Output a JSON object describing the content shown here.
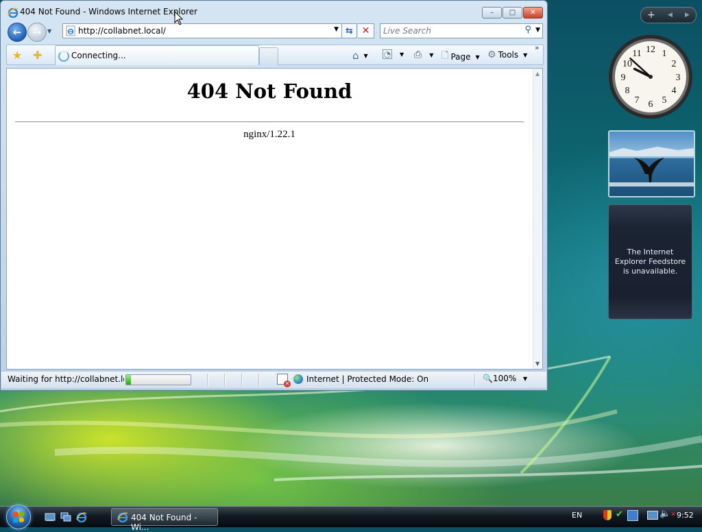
{
  "window": {
    "title": "404 Not Found - Windows Internet Explorer",
    "controls": {
      "minimize": "–",
      "maximize": "□",
      "close": "✕"
    }
  },
  "navbar": {
    "address": "http://collabnet.local/",
    "search_placeholder": "Live Search"
  },
  "commandbar": {
    "tab_label": "Connecting...",
    "page_label": "Page",
    "tools_label": "Tools",
    "chevron": "»"
  },
  "page": {
    "heading": "404 Not Found",
    "server": "nginx/1.22.1"
  },
  "status": {
    "text": "Waiting for http://collabnet.local/...",
    "progress": 0.07,
    "zone": "Internet | Protected Mode: On",
    "zoom": "100%"
  },
  "gadgets": {
    "feed_message": "The Internet Explorer Feedstore is unavailable.",
    "clock": {
      "hours": 9,
      "minutes": 52
    },
    "toolbar": {
      "add": "+",
      "prev": "◀",
      "next": "▶"
    }
  },
  "taskbar": {
    "task_label": "404 Not Found - Wi...",
    "language": "EN",
    "time": "9:52"
  },
  "colors": {
    "accent": "#1d5fb8",
    "progress_fill": "#25a31a",
    "close_button": "#c9402a"
  }
}
